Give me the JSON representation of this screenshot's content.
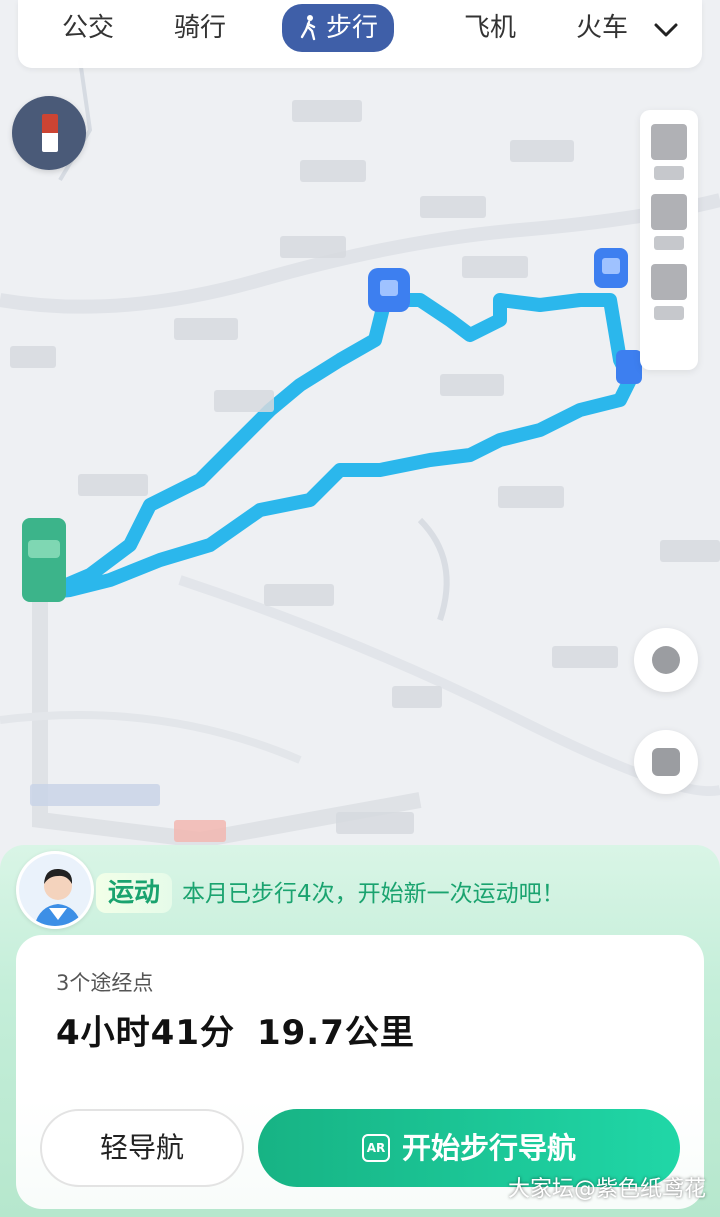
{
  "tabs": [
    {
      "label": "公交"
    },
    {
      "label": "骑行"
    },
    {
      "label": "步行"
    },
    {
      "label": "飞机"
    },
    {
      "label": "火车"
    }
  ],
  "active_tab": "步行",
  "icons": {
    "more": "chevron-down-icon",
    "walk": "walk-icon",
    "ar": "ar-icon"
  },
  "colors": {
    "route": "#2bb7ec",
    "accent": "#17b384",
    "tab_active": "#3f5fa8"
  },
  "sport": {
    "tag": "运动",
    "message": "本月已步行4次，开始新一次运动吧！"
  },
  "route": {
    "waypoints": "3个途经点",
    "duration": "4小时41分",
    "distance": "19.7公里"
  },
  "buttons": {
    "light_nav": "轻导航",
    "start_nav": "开始步行导航",
    "ar_glyph": "AR"
  },
  "watermark": "大家坛@紫色纸鸢花"
}
